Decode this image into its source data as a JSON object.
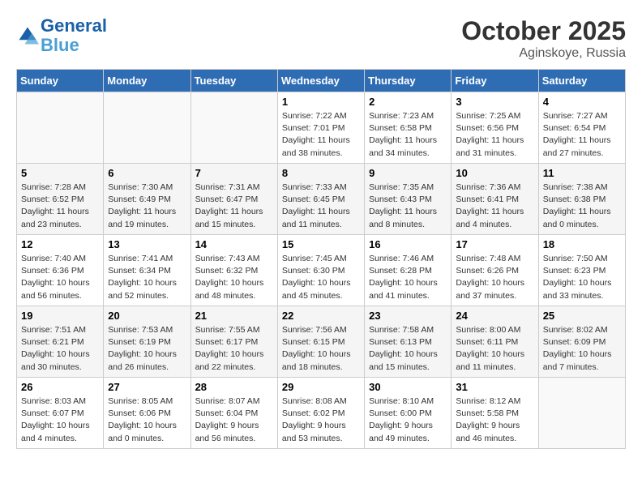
{
  "header": {
    "logo_line1": "General",
    "logo_line2": "Blue",
    "month_year": "October 2025",
    "location": "Aginskoye, Russia"
  },
  "weekdays": [
    "Sunday",
    "Monday",
    "Tuesday",
    "Wednesday",
    "Thursday",
    "Friday",
    "Saturday"
  ],
  "weeks": [
    [
      {
        "day": "",
        "info": ""
      },
      {
        "day": "",
        "info": ""
      },
      {
        "day": "",
        "info": ""
      },
      {
        "day": "1",
        "info": "Sunrise: 7:22 AM\nSunset: 7:01 PM\nDaylight: 11 hours\nand 38 minutes."
      },
      {
        "day": "2",
        "info": "Sunrise: 7:23 AM\nSunset: 6:58 PM\nDaylight: 11 hours\nand 34 minutes."
      },
      {
        "day": "3",
        "info": "Sunrise: 7:25 AM\nSunset: 6:56 PM\nDaylight: 11 hours\nand 31 minutes."
      },
      {
        "day": "4",
        "info": "Sunrise: 7:27 AM\nSunset: 6:54 PM\nDaylight: 11 hours\nand 27 minutes."
      }
    ],
    [
      {
        "day": "5",
        "info": "Sunrise: 7:28 AM\nSunset: 6:52 PM\nDaylight: 11 hours\nand 23 minutes."
      },
      {
        "day": "6",
        "info": "Sunrise: 7:30 AM\nSunset: 6:49 PM\nDaylight: 11 hours\nand 19 minutes."
      },
      {
        "day": "7",
        "info": "Sunrise: 7:31 AM\nSunset: 6:47 PM\nDaylight: 11 hours\nand 15 minutes."
      },
      {
        "day": "8",
        "info": "Sunrise: 7:33 AM\nSunset: 6:45 PM\nDaylight: 11 hours\nand 11 minutes."
      },
      {
        "day": "9",
        "info": "Sunrise: 7:35 AM\nSunset: 6:43 PM\nDaylight: 11 hours\nand 8 minutes."
      },
      {
        "day": "10",
        "info": "Sunrise: 7:36 AM\nSunset: 6:41 PM\nDaylight: 11 hours\nand 4 minutes."
      },
      {
        "day": "11",
        "info": "Sunrise: 7:38 AM\nSunset: 6:38 PM\nDaylight: 11 hours\nand 0 minutes."
      }
    ],
    [
      {
        "day": "12",
        "info": "Sunrise: 7:40 AM\nSunset: 6:36 PM\nDaylight: 10 hours\nand 56 minutes."
      },
      {
        "day": "13",
        "info": "Sunrise: 7:41 AM\nSunset: 6:34 PM\nDaylight: 10 hours\nand 52 minutes."
      },
      {
        "day": "14",
        "info": "Sunrise: 7:43 AM\nSunset: 6:32 PM\nDaylight: 10 hours\nand 48 minutes."
      },
      {
        "day": "15",
        "info": "Sunrise: 7:45 AM\nSunset: 6:30 PM\nDaylight: 10 hours\nand 45 minutes."
      },
      {
        "day": "16",
        "info": "Sunrise: 7:46 AM\nSunset: 6:28 PM\nDaylight: 10 hours\nand 41 minutes."
      },
      {
        "day": "17",
        "info": "Sunrise: 7:48 AM\nSunset: 6:26 PM\nDaylight: 10 hours\nand 37 minutes."
      },
      {
        "day": "18",
        "info": "Sunrise: 7:50 AM\nSunset: 6:23 PM\nDaylight: 10 hours\nand 33 minutes."
      }
    ],
    [
      {
        "day": "19",
        "info": "Sunrise: 7:51 AM\nSunset: 6:21 PM\nDaylight: 10 hours\nand 30 minutes."
      },
      {
        "day": "20",
        "info": "Sunrise: 7:53 AM\nSunset: 6:19 PM\nDaylight: 10 hours\nand 26 minutes."
      },
      {
        "day": "21",
        "info": "Sunrise: 7:55 AM\nSunset: 6:17 PM\nDaylight: 10 hours\nand 22 minutes."
      },
      {
        "day": "22",
        "info": "Sunrise: 7:56 AM\nSunset: 6:15 PM\nDaylight: 10 hours\nand 18 minutes."
      },
      {
        "day": "23",
        "info": "Sunrise: 7:58 AM\nSunset: 6:13 PM\nDaylight: 10 hours\nand 15 minutes."
      },
      {
        "day": "24",
        "info": "Sunrise: 8:00 AM\nSunset: 6:11 PM\nDaylight: 10 hours\nand 11 minutes."
      },
      {
        "day": "25",
        "info": "Sunrise: 8:02 AM\nSunset: 6:09 PM\nDaylight: 10 hours\nand 7 minutes."
      }
    ],
    [
      {
        "day": "26",
        "info": "Sunrise: 8:03 AM\nSunset: 6:07 PM\nDaylight: 10 hours\nand 4 minutes."
      },
      {
        "day": "27",
        "info": "Sunrise: 8:05 AM\nSunset: 6:06 PM\nDaylight: 10 hours\nand 0 minutes."
      },
      {
        "day": "28",
        "info": "Sunrise: 8:07 AM\nSunset: 6:04 PM\nDaylight: 9 hours\nand 56 minutes."
      },
      {
        "day": "29",
        "info": "Sunrise: 8:08 AM\nSunset: 6:02 PM\nDaylight: 9 hours\nand 53 minutes."
      },
      {
        "day": "30",
        "info": "Sunrise: 8:10 AM\nSunset: 6:00 PM\nDaylight: 9 hours\nand 49 minutes."
      },
      {
        "day": "31",
        "info": "Sunrise: 8:12 AM\nSunset: 5:58 PM\nDaylight: 9 hours\nand 46 minutes."
      },
      {
        "day": "",
        "info": ""
      }
    ]
  ]
}
